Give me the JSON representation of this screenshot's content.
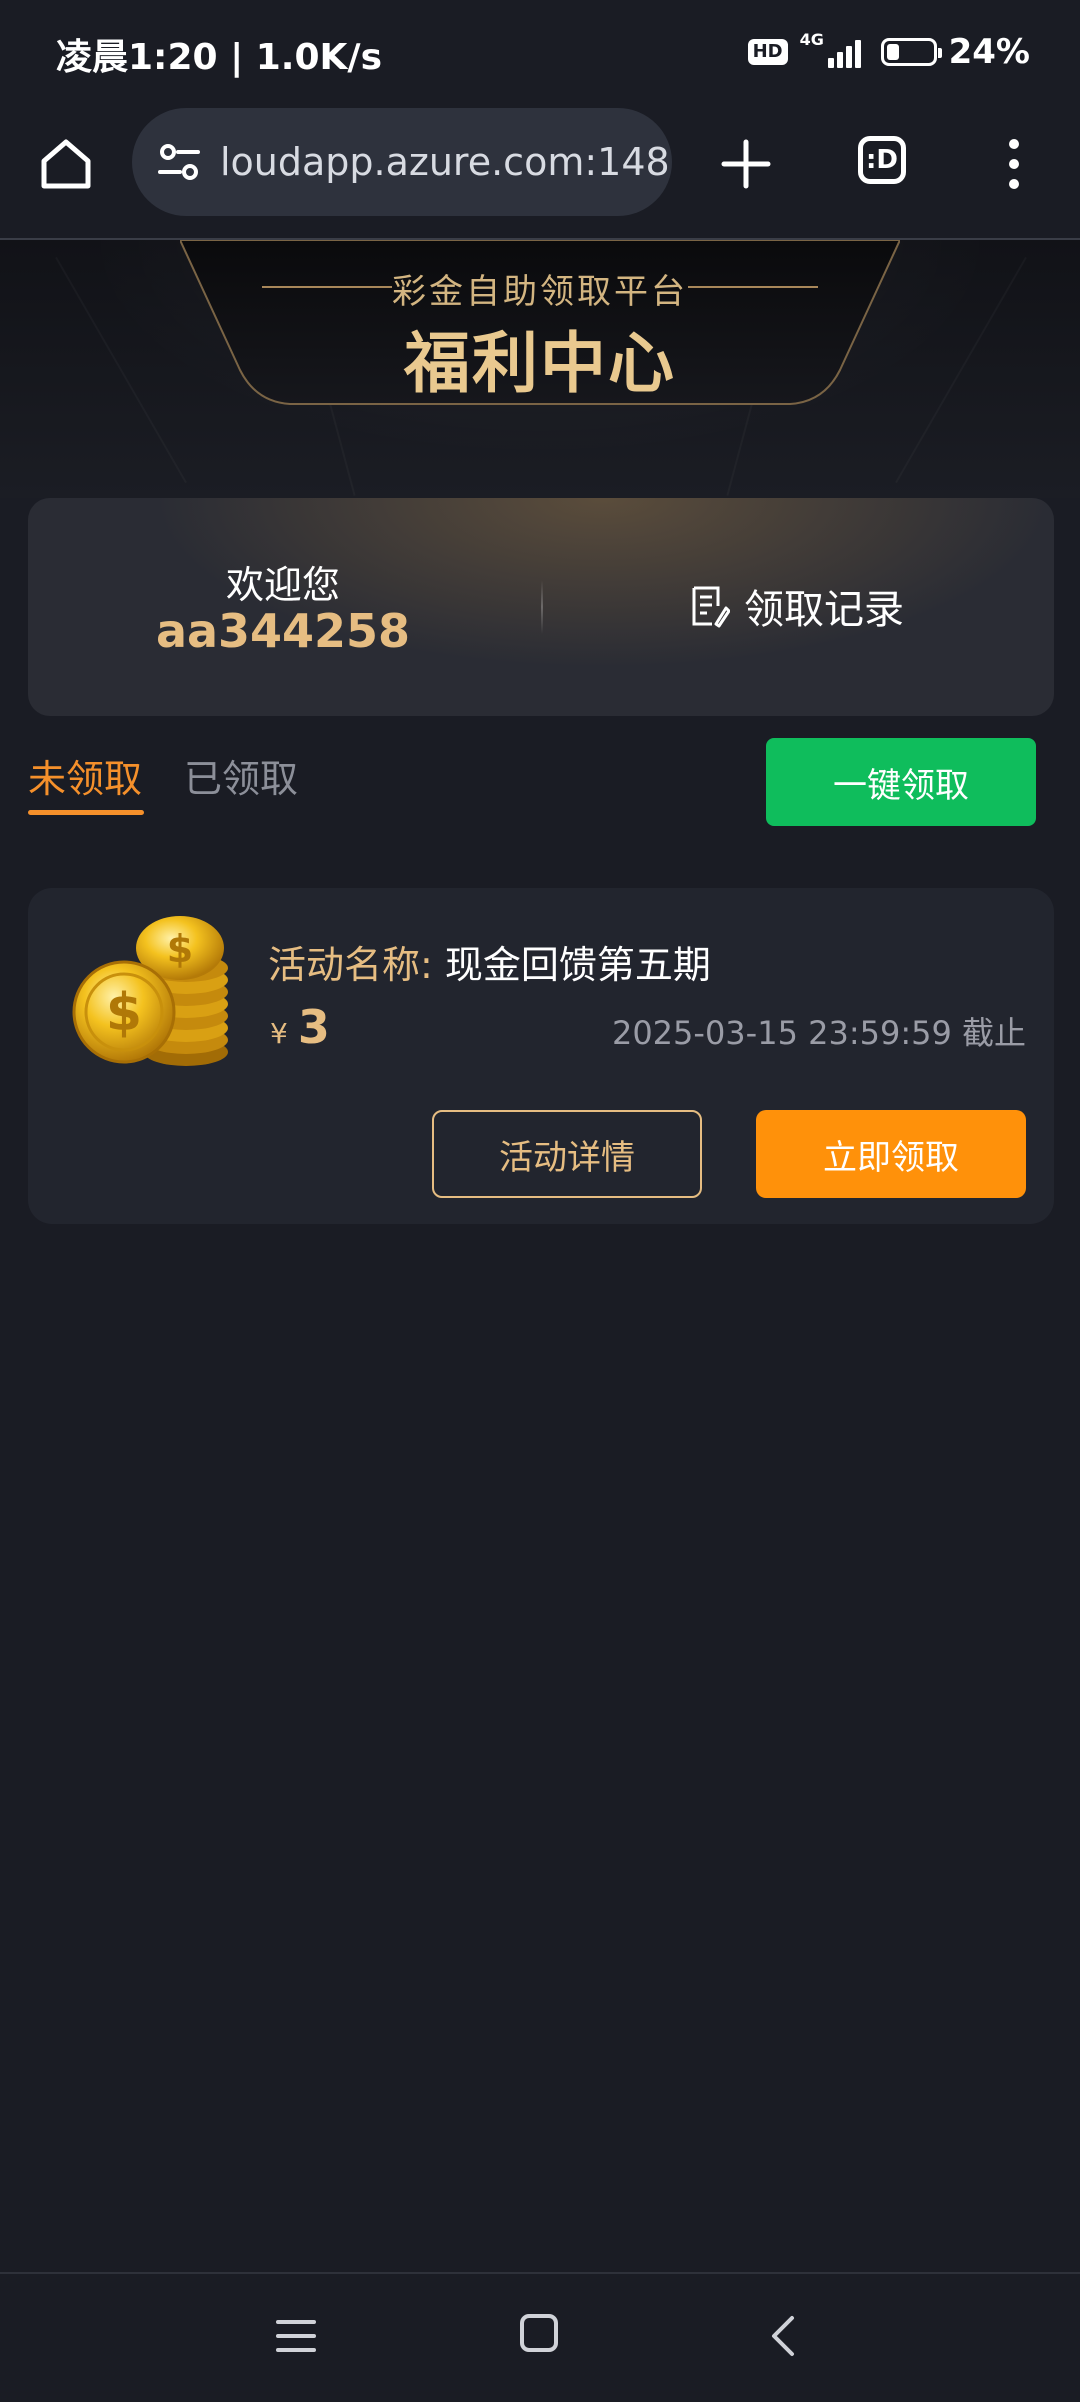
{
  "status_bar": {
    "time": "凌晨1:20 | 1.0K/s",
    "hd": "HD",
    "network": "4G",
    "battery": "24%",
    "battery_level": 0.24
  },
  "browser": {
    "url": "loudapp.azure.com:148",
    "tab_icon_label": ":D",
    "icons": [
      "home-icon",
      "site-settings-icon",
      "plus-icon",
      "tabs-icon",
      "more-vert-icon"
    ]
  },
  "hero": {
    "subtitle": "彩金自助领取平台",
    "title": "福利中心"
  },
  "welcome": {
    "label": "欢迎您",
    "username": "aa344258",
    "records_label": "领取记录"
  },
  "tabs": {
    "unclaimed": "未领取",
    "claimed": "已领取",
    "claim_all": "一键领取"
  },
  "activities": [
    {
      "name_label": "活动名称:",
      "name": "现金回馈第五期",
      "currency": "¥",
      "amount": "3",
      "deadline": "2025-03-15 23:59:59 截止",
      "details_label": "活动详情",
      "claim_label": "立即领取"
    }
  ],
  "colors": {
    "background": "#1a1c24",
    "accent_orange": "#ff910a",
    "accent_green": "#0fbd5c",
    "gold_text": "#e6bd82"
  }
}
